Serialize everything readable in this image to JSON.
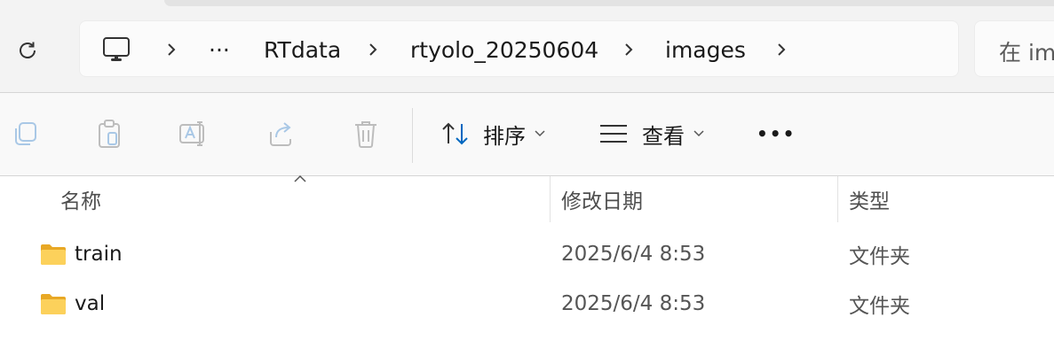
{
  "address_bar": {
    "breadcrumbs": [
      "RTdata",
      "rtyolo_20250604",
      "images"
    ],
    "ellipsis": "···"
  },
  "search": {
    "placeholder": "在 images 中搜索"
  },
  "toolbar": {
    "sort_label": "排序",
    "view_label": "查看",
    "more": "•••"
  },
  "columns": {
    "name": "名称",
    "date": "修改日期",
    "type": "类型"
  },
  "files": [
    {
      "name": "train",
      "modified": "2025/6/4 8:53",
      "type": "文件夹"
    },
    {
      "name": "val",
      "modified": "2025/6/4 8:53",
      "type": "文件夹"
    }
  ],
  "colors": {
    "folder": "#f7c948",
    "accent": "#0067c0"
  }
}
